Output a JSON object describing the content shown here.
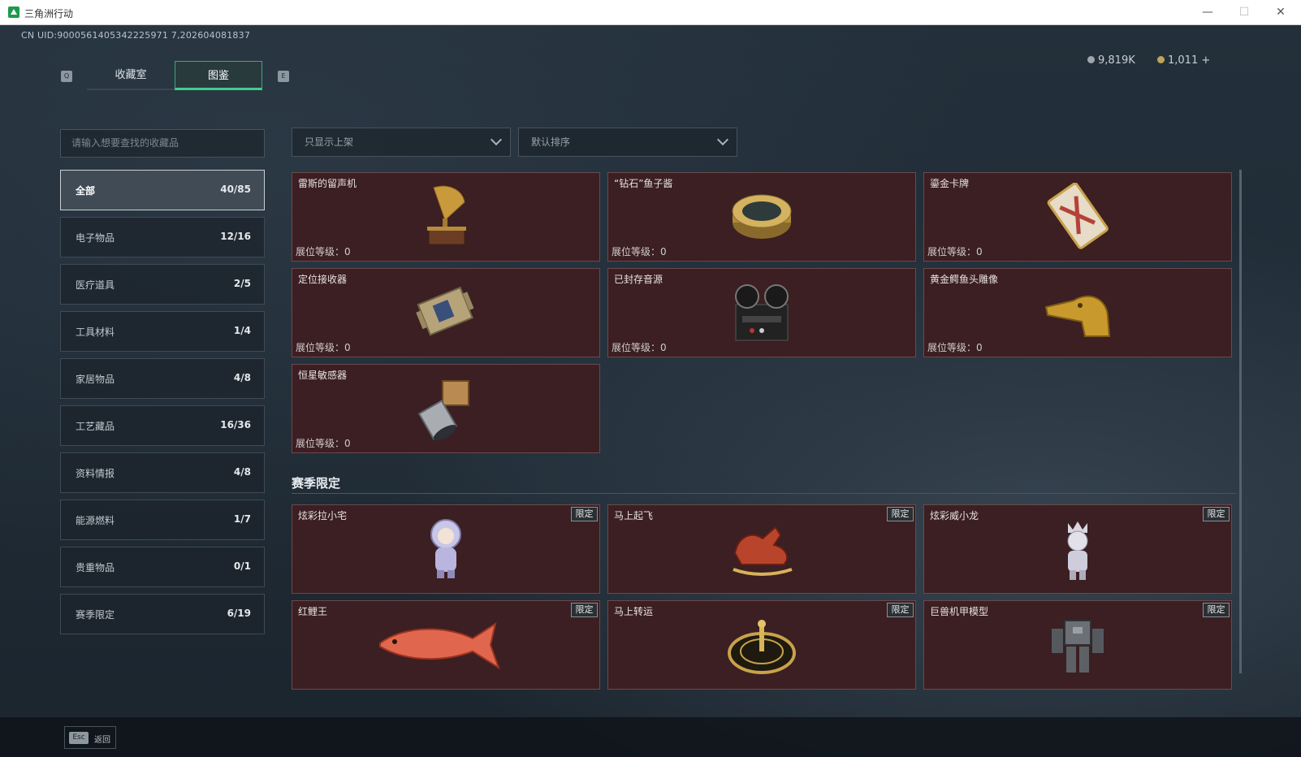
{
  "window": {
    "title": "三角洲行动",
    "minimize": "—",
    "maximize": "☐",
    "close": "✕"
  },
  "header": {
    "uid": "CN UID:9000561405342225971 7,202604081837",
    "silver": "9,819K",
    "gold": "1,011 +"
  },
  "tabs": {
    "prev_key": "Q",
    "next_key": "E",
    "items": [
      {
        "label": "收藏室"
      },
      {
        "label": "图鉴"
      }
    ]
  },
  "search": {
    "placeholder": "请输入想要查找的收藏品"
  },
  "filters": {
    "filter_label": "只显示上架",
    "sort_label": "默认排序"
  },
  "categories": [
    {
      "label": "全部",
      "count": "40/85"
    },
    {
      "label": "电子物品",
      "count": "12/16"
    },
    {
      "label": "医疗道具",
      "count": "2/5"
    },
    {
      "label": "工具材料",
      "count": "1/4"
    },
    {
      "label": "家居物品",
      "count": "4/8"
    },
    {
      "label": "工艺藏品",
      "count": "16/36"
    },
    {
      "label": "资料情报",
      "count": "4/8"
    },
    {
      "label": "能源燃料",
      "count": "1/7"
    },
    {
      "label": "贵重物品",
      "count": "0/1"
    },
    {
      "label": "赛季限定",
      "count": "6/19"
    }
  ],
  "items": [
    {
      "name": "雷斯的留声机",
      "level": "展位等级：0",
      "icon": "gramophone-icon"
    },
    {
      "name": "“钻石”鱼子酱",
      "level": "展位等级：0",
      "icon": "caviar-tin-icon"
    },
    {
      "name": "鎏金卡牌",
      "level": "展位等级：0",
      "icon": "gilded-card-icon"
    },
    {
      "name": "定位接收器",
      "level": "展位等级：0",
      "icon": "receiver-icon"
    },
    {
      "name": "已封存音源",
      "level": "展位等级：0",
      "icon": "tape-recorder-icon"
    },
    {
      "name": "黄金鳄鱼头雕像",
      "level": "展位等级：0",
      "icon": "gold-crocodile-icon"
    },
    {
      "name": "恒星敏感器",
      "level": "展位等级：0",
      "icon": "star-sensor-icon"
    }
  ],
  "season": {
    "title": "赛季限定",
    "badge": "限定",
    "items": [
      {
        "name": "炫彩拉小宅",
        "icon": "figurine-astronaut-icon"
      },
      {
        "name": "马上起飞",
        "icon": "red-horse-icon"
      },
      {
        "name": "炫彩威小龙",
        "icon": "figurine-crown-icon"
      },
      {
        "name": "红鲤王",
        "icon": "red-carp-icon"
      },
      {
        "name": "马上转运",
        "icon": "gold-compass-icon"
      },
      {
        "name": "巨兽机甲模型",
        "icon": "mech-model-icon"
      }
    ]
  },
  "footer": {
    "esc_key": "Esc",
    "back_label": "返回"
  }
}
